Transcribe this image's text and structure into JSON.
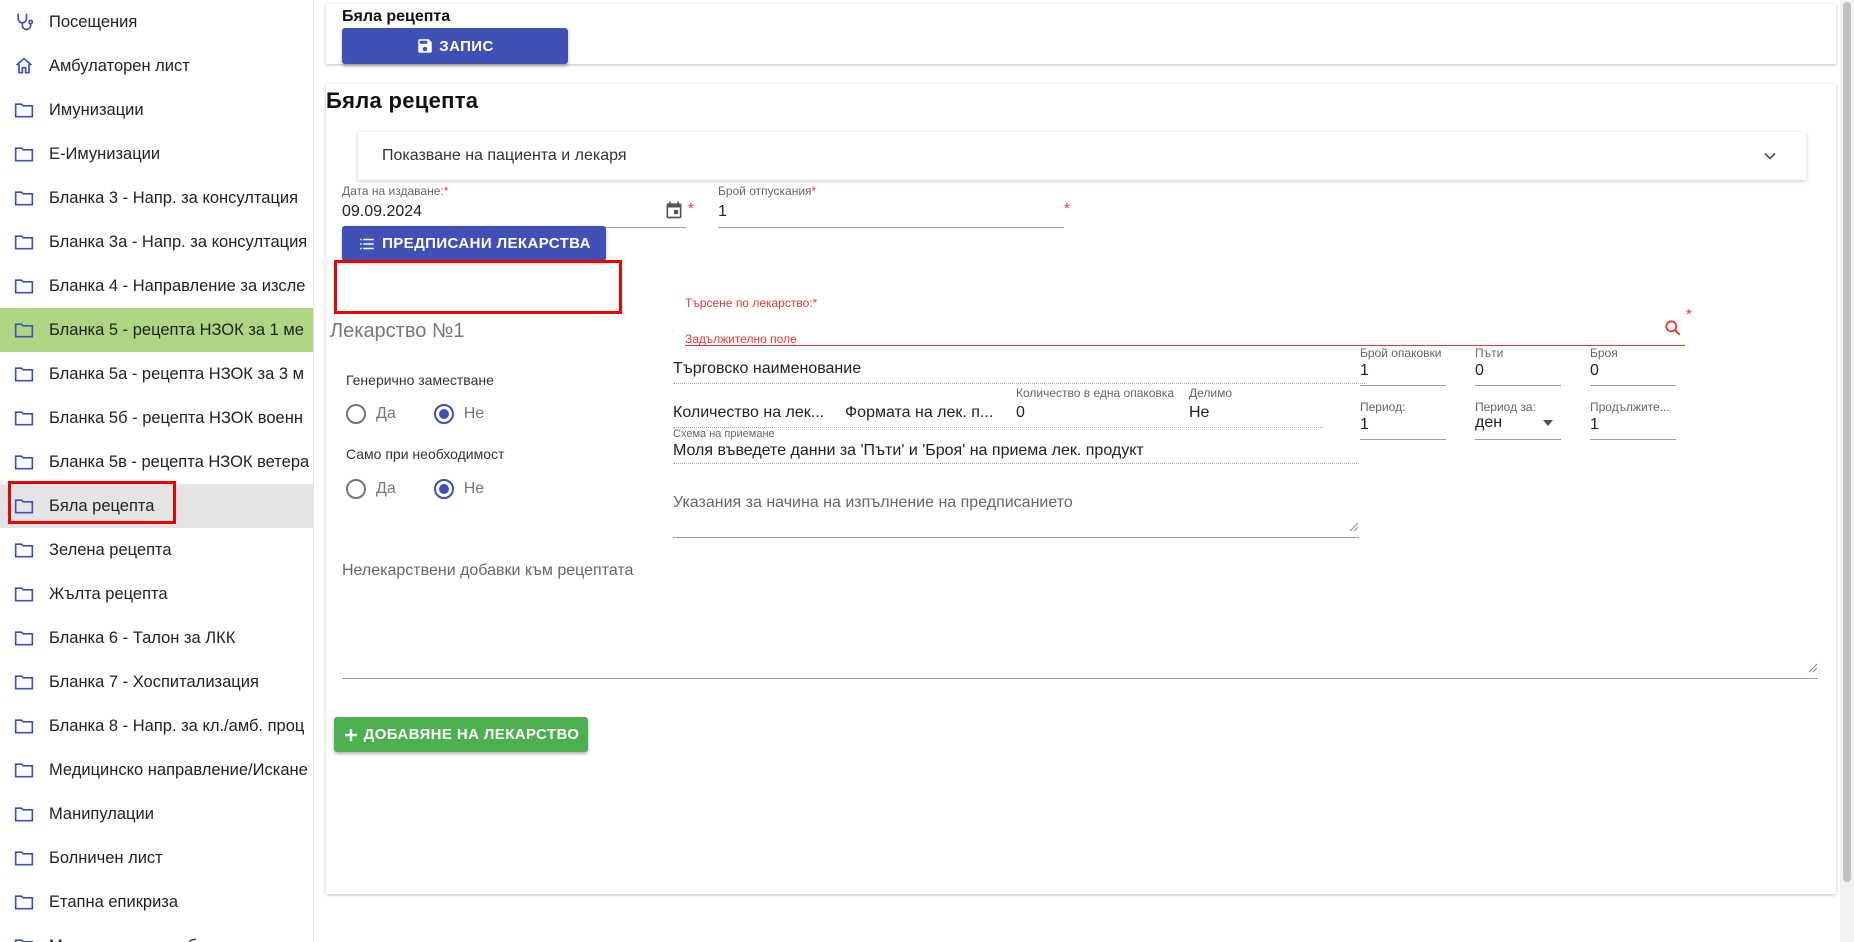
{
  "sidebar": {
    "items": [
      {
        "label": "Посещения",
        "icon": "stethoscope-icon"
      },
      {
        "label": "Амбулаторен лист",
        "icon": "home-icon"
      },
      {
        "label": "Имунизации",
        "icon": "folder-icon"
      },
      {
        "label": "Е-Имунизации",
        "icon": "folder-icon"
      },
      {
        "label": "Бланка 3 - Напр. за консултация",
        "icon": "folder-icon"
      },
      {
        "label": "Бланка 3а - Напр. за консултация",
        "icon": "folder-icon"
      },
      {
        "label": "Бланка 4 - Направление за изсле",
        "icon": "folder-icon"
      },
      {
        "label": "Бланка 5 - рецепта НЗОК за 1 ме",
        "icon": "folder-icon"
      },
      {
        "label": "Бланка 5а - рецепта НЗОК за 3 м",
        "icon": "folder-icon"
      },
      {
        "label": "Бланка 5б - рецепта НЗОК военн",
        "icon": "folder-icon"
      },
      {
        "label": "Бланка 5в - рецепта НЗОК ветера",
        "icon": "folder-icon"
      },
      {
        "label": "Бяла рецепта",
        "icon": "folder-icon"
      },
      {
        "label": "Зелена рецепта",
        "icon": "folder-icon"
      },
      {
        "label": "Жълта рецепта",
        "icon": "folder-icon"
      },
      {
        "label": "Бланка 6 - Талон за ЛКК",
        "icon": "folder-icon"
      },
      {
        "label": "Бланка 7 - Хоспитализация",
        "icon": "folder-icon"
      },
      {
        "label": "Бланка 8 - Напр. за кл./амб. проц",
        "icon": "folder-icon"
      },
      {
        "label": "Медицинско направление/Искане",
        "icon": "folder-icon"
      },
      {
        "label": "Манипулации",
        "icon": "folder-icon"
      },
      {
        "label": "Болничен лист",
        "icon": "folder-icon"
      },
      {
        "label": "Етапна епикриза",
        "icon": "folder-icon"
      },
      {
        "label": "Медицинско за работа",
        "icon": "folder-icon"
      }
    ]
  },
  "top": {
    "title": "Бяла рецепта",
    "save_label": "ЗАПИС"
  },
  "main": {
    "title": "Бяла рецепта",
    "expander_label": "Показване на пациента и лекаря",
    "issue_date": {
      "label": "Дата на издаване:",
      "value": "09.09.2024"
    },
    "dispense_count": {
      "label": "Брой отпускания",
      "value": "1"
    },
    "prescribed_button": "ПРЕДПИСАНИ ЛЕКАРСТВА",
    "drug_title": "Лекарство №1",
    "search": {
      "label": "Търсене по лекарство:",
      "error": "Задължително поле"
    },
    "trade_name_placeholder": "Търговско наименование",
    "packages": {
      "label": "Брой опаковки",
      "value": "1"
    },
    "times": {
      "label": "Пъти",
      "value": "0"
    },
    "count": {
      "label": "Броя",
      "value": "0"
    },
    "generic": {
      "label": "Генерично заместване",
      "yes": "Да",
      "no": "Не",
      "selected": "Не"
    },
    "qty_drug_placeholder": "Количество на лек...",
    "form_placeholder": "Формата на лек. п...",
    "qty_per_pack": {
      "label": "Количество в една опаковка",
      "value": "0"
    },
    "divisible": {
      "label": "Делимо",
      "value": "Не"
    },
    "period": {
      "label": "Период:",
      "value": "1"
    },
    "period_for": {
      "label": "Период за:",
      "value": "ден"
    },
    "duration": {
      "label": "Продължите...",
      "value": "1"
    },
    "only_if_needed": {
      "label": "Само при необходимост",
      "yes": "Да",
      "no": "Не",
      "selected": "Не"
    },
    "scheme": {
      "label": "Схема на приемане",
      "placeholder": "Моля въведете данни за 'Пъти' и 'Броя' на приема лек. продукт"
    },
    "instructions_placeholder": "Указания за начина на изпълнение на предписанието",
    "non_drug_placeholder": "Нелекарствени добавки към рецептата",
    "add_drug_button": "ДОБАВЯНЕ НА ЛЕКАРСТВО"
  },
  "colors": {
    "primary": "#3f51b5",
    "success": "#4caf50",
    "active_green": "#aed581",
    "error": "#e53935",
    "highlight": "#ee0000"
  }
}
